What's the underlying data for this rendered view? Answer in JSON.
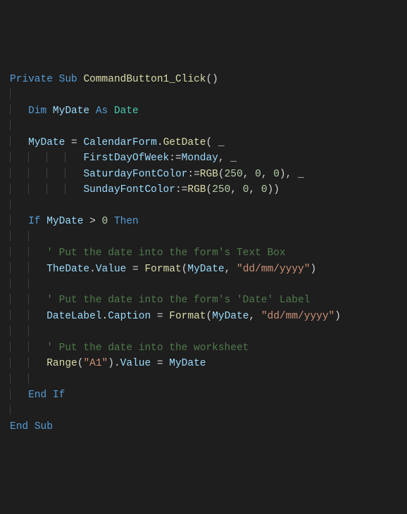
{
  "code": {
    "l1": {
      "kw1": "Private",
      "kw2": "Sub",
      "fn": "CommandButton1_Click",
      "paren": "()"
    },
    "l3": {
      "kw1": "Dim",
      "var": "MyDate",
      "kw2": "As",
      "type": "Date"
    },
    "l5": {
      "var": "MyDate",
      "eq": " = ",
      "obj": "CalendarForm",
      "dot": ".",
      "fn": "GetDate",
      "open": "( _"
    },
    "l6": {
      "param": "FirstDayOfWeek",
      "op": ":=",
      "val": "Monday",
      "cont": ", _"
    },
    "l7": {
      "param": "SaturdayFontColor",
      "op": ":=",
      "fn": "RGB",
      "open": "(",
      "n1": "250",
      "c1": ", ",
      "n2": "0",
      "c2": ", ",
      "n3": "0",
      "close": "), _"
    },
    "l8": {
      "param": "SundayFontColor",
      "op": ":=",
      "fn": "RGB",
      "open": "(",
      "n1": "250",
      "c1": ", ",
      "n2": "0",
      "c2": ", ",
      "n3": "0",
      "close": "))"
    },
    "l10": {
      "kw1": "If",
      "var": "MyDate",
      "op": " > ",
      "num": "0",
      "kw2": "Then"
    },
    "l12": {
      "cmt": "' Put the date into the form's Text Box"
    },
    "l13": {
      "obj": "TheDate",
      "dot": ".",
      "prop": "Value",
      "eq": " = ",
      "fn": "Format",
      "open": "(",
      "arg": "MyDate",
      "c": ", ",
      "str": "\"dd/mm/yyyy\"",
      "close": ")"
    },
    "l15": {
      "cmt": "' Put the date into the form's 'Date' Label"
    },
    "l16": {
      "obj": "DateLabel",
      "dot": ".",
      "prop": "Caption",
      "eq": " = ",
      "fn": "Format",
      "open": "(",
      "arg": "MyDate",
      "c": ", ",
      "str": "\"dd/mm/yyyy\"",
      "close": ")"
    },
    "l18": {
      "cmt": "' Put the date into the worksheet"
    },
    "l19": {
      "fn": "Range",
      "open": "(",
      "str": "\"A1\"",
      "close": ")",
      "dot": ".",
      "prop": "Value",
      "eq": " = ",
      "var": "MyDate"
    },
    "l21": {
      "kw1": "End",
      "kw2": "If"
    },
    "l23": {
      "kw1": "End",
      "kw2": "Sub"
    }
  }
}
